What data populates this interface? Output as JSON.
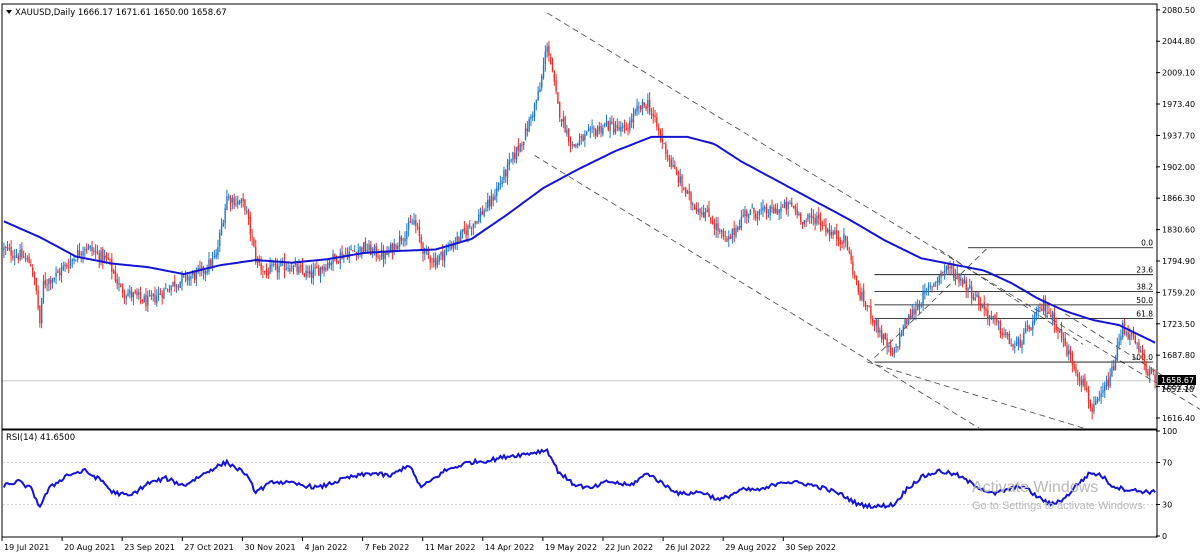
{
  "window": {
    "symbol_header": "XAUUSD,Daily  1666.17 1671.61 1650.00 1658.67",
    "indicator_header": "RSI(14) 41.6500",
    "current_price_tag": "1658.67",
    "current_price_under": "1652.10"
  },
  "watermark": {
    "line1": "Activate Windows",
    "line2": "Go to Settings to activate Windows."
  },
  "colors": {
    "bull": "#1f78c8",
    "bear": "#e8302a",
    "ma": "#1414d2",
    "rsi": "#1414d2",
    "grid": "#000000",
    "fib": "#000000"
  },
  "chart_data": [
    {
      "type": "candlestick",
      "title": "",
      "symbol": "XAUUSD",
      "timeframe": "Daily",
      "ohlc_last": {
        "open": 1666.17,
        "high": 1671.61,
        "low": 1650.0,
        "close": 1658.67
      },
      "y_ticks": [
        "2080.50",
        "2044.80",
        "2009.10",
        "1973.40",
        "1937.70",
        "1902.00",
        "1866.30",
        "1830.60",
        "1794.90",
        "1759.20",
        "1723.50",
        "1687.80",
        "1652.10",
        "1616.40"
      ],
      "ylim": [
        1605.0,
        2086.0
      ],
      "x_ticks": [
        "19 Jul 2021",
        "20 Aug 2021",
        "23 Sep 2021",
        "27 Oct 2021",
        "30 Nov 2021",
        "4 Jan 2022",
        "7 Feb 2022",
        "11 Mar 2022",
        "14 Apr 2022",
        "19 May 2022",
        "22 Jun 2022",
        "26 Jul 2022",
        "29 Aug 2022",
        "30 Sep 2022"
      ],
      "close_anchors": [
        [
          0,
          1808
        ],
        [
          10,
          1800
        ],
        [
          15,
          1792
        ],
        [
          18,
          1760
        ],
        [
          20,
          1724
        ],
        [
          22,
          1770
        ],
        [
          30,
          1780
        ],
        [
          45,
          1812
        ],
        [
          58,
          1795
        ],
        [
          65,
          1762
        ],
        [
          80,
          1748
        ],
        [
          95,
          1770
        ],
        [
          110,
          1782
        ],
        [
          118,
          1800
        ],
        [
          124,
          1868
        ],
        [
          134,
          1858
        ],
        [
          140,
          1798
        ],
        [
          145,
          1782
        ],
        [
          158,
          1790
        ],
        [
          170,
          1778
        ],
        [
          185,
          1800
        ],
        [
          200,
          1810
        ],
        [
          212,
          1800
        ],
        [
          228,
          1840
        ],
        [
          234,
          1803
        ],
        [
          240,
          1795
        ],
        [
          255,
          1825
        ],
        [
          270,
          1860
        ],
        [
          280,
          1900
        ],
        [
          290,
          1940
        ],
        [
          298,
          1990
        ],
        [
          302,
          2043
        ],
        [
          308,
          1970
        ],
        [
          316,
          1925
        ],
        [
          325,
          1938
        ],
        [
          335,
          1950
        ],
        [
          345,
          1942
        ],
        [
          352,
          1965
        ],
        [
          358,
          1975
        ],
        [
          362,
          1952
        ],
        [
          372,
          1900
        ],
        [
          382,
          1862
        ],
        [
          392,
          1846
        ],
        [
          402,
          1815
        ],
        [
          412,
          1850
        ],
        [
          425,
          1850
        ],
        [
          438,
          1858
        ],
        [
          445,
          1840
        ],
        [
          452,
          1845
        ],
        [
          460,
          1826
        ],
        [
          468,
          1818
        ],
        [
          475,
          1760
        ],
        [
          482,
          1735
        ],
        [
          488,
          1710
        ],
        [
          494,
          1685
        ],
        [
          500,
          1720
        ],
        [
          508,
          1745
        ],
        [
          516,
          1768
        ],
        [
          524,
          1788
        ],
        [
          532,
          1775
        ],
        [
          540,
          1755
        ],
        [
          548,
          1732
        ],
        [
          556,
          1712
        ],
        [
          562,
          1695
        ],
        [
          570,
          1718
        ],
        [
          578,
          1745
        ],
        [
          584,
          1728
        ],
        [
          590,
          1698
        ],
        [
          596,
          1672
        ],
        [
          602,
          1648
        ],
        [
          605,
          1622
        ],
        [
          610,
          1640
        ],
        [
          616,
          1668
        ],
        [
          622,
          1720
        ],
        [
          628,
          1705
        ],
        [
          636,
          1670
        ],
        [
          640,
          1660
        ]
      ],
      "fibonacci": {
        "levels": [
          "0.0",
          "23.6",
          "38.2",
          "50.0",
          "61.8",
          "100.0"
        ],
        "high": 1810.0,
        "low": 1680.0
      },
      "moving_average_anchors": [
        [
          0,
          1840
        ],
        [
          20,
          1822
        ],
        [
          40,
          1800
        ],
        [
          60,
          1792
        ],
        [
          80,
          1788
        ],
        [
          100,
          1780
        ],
        [
          120,
          1790
        ],
        [
          140,
          1796
        ],
        [
          160,
          1793
        ],
        [
          180,
          1797
        ],
        [
          200,
          1804
        ],
        [
          215,
          1806
        ],
        [
          240,
          1808
        ],
        [
          260,
          1820
        ],
        [
          280,
          1848
        ],
        [
          300,
          1878
        ],
        [
          320,
          1900
        ],
        [
          340,
          1920
        ],
        [
          360,
          1936
        ],
        [
          380,
          1936
        ],
        [
          395,
          1928
        ],
        [
          410,
          1908
        ],
        [
          430,
          1886
        ],
        [
          450,
          1864
        ],
        [
          470,
          1842
        ],
        [
          490,
          1818
        ],
        [
          510,
          1798
        ],
        [
          530,
          1790
        ],
        [
          545,
          1784
        ],
        [
          560,
          1770
        ],
        [
          575,
          1752
        ],
        [
          590,
          1738
        ],
        [
          605,
          1728
        ],
        [
          620,
          1722
        ],
        [
          630,
          1712
        ],
        [
          640,
          1702
        ]
      ]
    },
    {
      "type": "line",
      "title": "",
      "name": "RSI(14)",
      "value_last": 41.65,
      "y_ticks": [
        "100",
        "70",
        "30",
        "0"
      ],
      "ylim": [
        0,
        100
      ],
      "anchors": [
        [
          0,
          48
        ],
        [
          8,
          52
        ],
        [
          15,
          45
        ],
        [
          20,
          28
        ],
        [
          25,
          45
        ],
        [
          35,
          58
        ],
        [
          45,
          62
        ],
        [
          55,
          52
        ],
        [
          60,
          42
        ],
        [
          70,
          38
        ],
        [
          80,
          50
        ],
        [
          90,
          55
        ],
        [
          100,
          48
        ],
        [
          110,
          58
        ],
        [
          118,
          66
        ],
        [
          124,
          70
        ],
        [
          134,
          60
        ],
        [
          140,
          42
        ],
        [
          150,
          52
        ],
        [
          160,
          50
        ],
        [
          175,
          46
        ],
        [
          190,
          55
        ],
        [
          205,
          60
        ],
        [
          215,
          57
        ],
        [
          225,
          68
        ],
        [
          232,
          46
        ],
        [
          245,
          62
        ],
        [
          258,
          70
        ],
        [
          270,
          72
        ],
        [
          280,
          76
        ],
        [
          290,
          78
        ],
        [
          296,
          80
        ],
        [
          302,
          82
        ],
        [
          308,
          62
        ],
        [
          316,
          50
        ],
        [
          326,
          45
        ],
        [
          336,
          52
        ],
        [
          348,
          48
        ],
        [
          358,
          60
        ],
        [
          366,
          50
        ],
        [
          376,
          40
        ],
        [
          388,
          42
        ],
        [
          398,
          34
        ],
        [
          410,
          44
        ],
        [
          422,
          44
        ],
        [
          432,
          52
        ],
        [
          445,
          50
        ],
        [
          455,
          46
        ],
        [
          465,
          40
        ],
        [
          475,
          30
        ],
        [
          485,
          28
        ],
        [
          495,
          30
        ],
        [
          502,
          45
        ],
        [
          510,
          56
        ],
        [
          520,
          62
        ],
        [
          530,
          58
        ],
        [
          540,
          48
        ],
        [
          550,
          40
        ],
        [
          558,
          44
        ],
        [
          566,
          48
        ],
        [
          574,
          38
        ],
        [
          582,
          30
        ],
        [
          590,
          36
        ],
        [
          596,
          48
        ],
        [
          604,
          60
        ],
        [
          610,
          58
        ],
        [
          616,
          48
        ],
        [
          622,
          45
        ],
        [
          630,
          43
        ],
        [
          640,
          41.65
        ]
      ]
    }
  ]
}
